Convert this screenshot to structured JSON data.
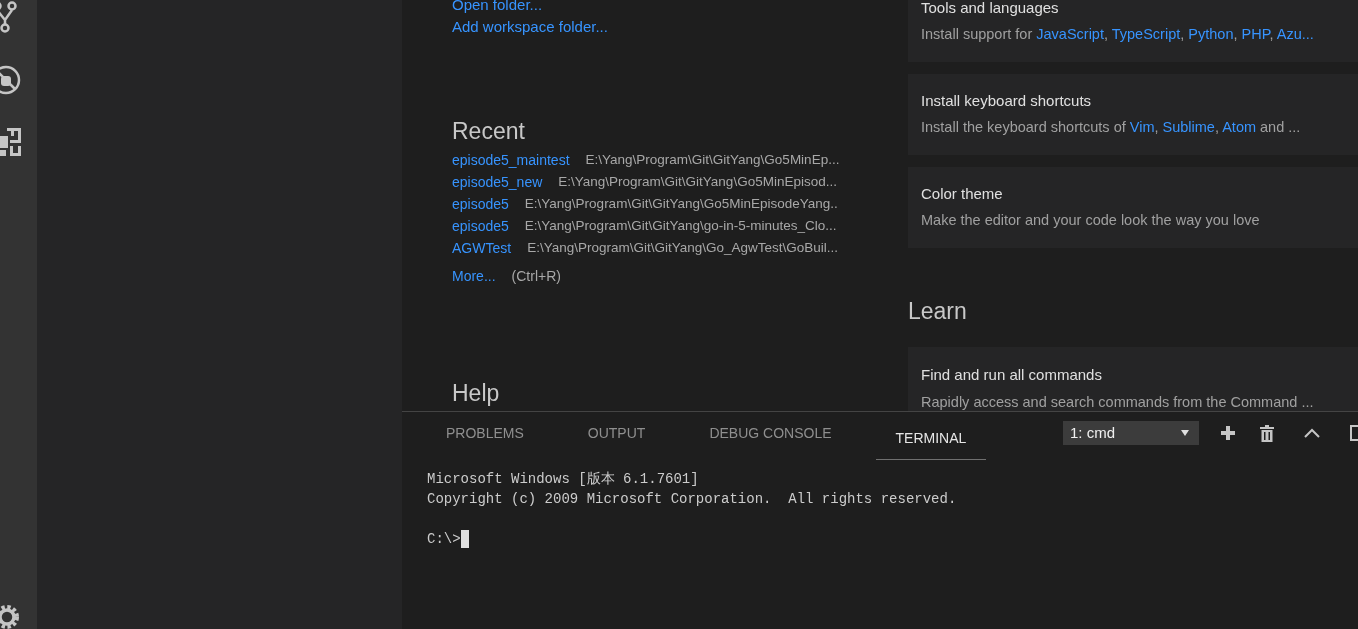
{
  "start": {
    "links": [
      "Open folder...",
      "Add workspace folder..."
    ]
  },
  "recent": {
    "title": "Recent",
    "items": [
      {
        "name": "episode5_maintest",
        "path": "E:\\Yang\\Program\\Git\\GitYang\\Go5MinEp..."
      },
      {
        "name": "episode5_new",
        "path": "E:\\Yang\\Program\\Git\\GitYang\\Go5MinEpisod..."
      },
      {
        "name": "episode5",
        "path": "E:\\Yang\\Program\\Git\\GitYang\\Go5MinEpisodeYang.."
      },
      {
        "name": "episode5",
        "path": "E:\\Yang\\Program\\Git\\GitYang\\go-in-5-minutes_Clo..."
      },
      {
        "name": "AGWTest",
        "path": "E:\\Yang\\Program\\Git\\GitYang\\Go_AgwTest\\GoBuil..."
      }
    ],
    "more": "More...",
    "shortcut": "(Ctrl+R)"
  },
  "help": {
    "title": "Help"
  },
  "customize_cards": [
    {
      "title": "Tools and languages",
      "description": [
        {
          "kind": "text",
          "text": "Install support for "
        },
        {
          "kind": "link",
          "text": "JavaScript"
        },
        {
          "kind": "text",
          "text": ", "
        },
        {
          "kind": "link",
          "text": "TypeScript"
        },
        {
          "kind": "text",
          "text": ", "
        },
        {
          "kind": "link",
          "text": "Python"
        },
        {
          "kind": "text",
          "text": ", "
        },
        {
          "kind": "link",
          "text": "PHP"
        },
        {
          "kind": "text",
          "text": ", "
        },
        {
          "kind": "link",
          "text": "Azu..."
        }
      ]
    },
    {
      "title": "Install keyboard shortcuts",
      "description": [
        {
          "kind": "text",
          "text": "Install the keyboard shortcuts of "
        },
        {
          "kind": "link",
          "text": "Vim"
        },
        {
          "kind": "text",
          "text": ", "
        },
        {
          "kind": "link",
          "text": "Sublime"
        },
        {
          "kind": "text",
          "text": ", "
        },
        {
          "kind": "link",
          "text": "Atom"
        },
        {
          "kind": "text",
          "text": " and ..."
        }
      ]
    },
    {
      "title": "Color theme",
      "description": [
        {
          "kind": "text",
          "text": "Make the editor and your code look the way you love"
        }
      ]
    }
  ],
  "learn": {
    "title": "Learn",
    "cards": [
      {
        "title": "Find and run all commands",
        "description": [
          {
            "kind": "text",
            "text": "Rapidly access and search commands from the Command ..."
          }
        ]
      }
    ]
  },
  "panel": {
    "tabs": [
      {
        "label": "PROBLEMS",
        "selected": false
      },
      {
        "label": "OUTPUT",
        "selected": false
      },
      {
        "label": "DEBUG CONSOLE",
        "selected": false
      },
      {
        "label": "TERMINAL",
        "selected": true
      }
    ],
    "terminal_select": "1: cmd",
    "terminal_output": [
      "Microsoft Windows [版本 6.1.7601]",
      "Copyright (c) 2009 Microsoft Corporation.  All rights reserved."
    ],
    "terminal_prompt": "C:\\>"
  }
}
